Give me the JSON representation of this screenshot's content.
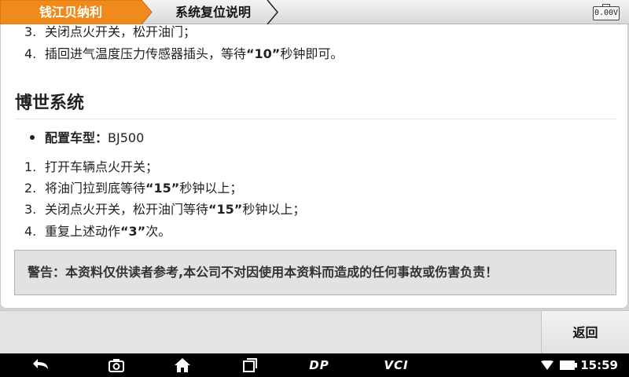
{
  "breadcrumb": {
    "items": [
      {
        "label": "钱江贝纳利",
        "color": "#f08a1c"
      },
      {
        "label": "系统复位说明"
      }
    ]
  },
  "status": {
    "voltage": "0.00V"
  },
  "content": {
    "prev_steps": [
      {
        "num": "3.",
        "pre": "关闭点火开关，松开油门；",
        "bold": "",
        "post": ""
      },
      {
        "num": "4.",
        "pre": "插回进气温度压力传感器插头，等待",
        "bold": "“10”",
        "post": "秒钟即可。"
      }
    ],
    "section_title": "博世系统",
    "config": {
      "label": "配置车型：",
      "value": "BJ500"
    },
    "steps": [
      {
        "num": "1.",
        "pre": "打开车辆点火开关；",
        "bold": "",
        "post": ""
      },
      {
        "num": "2.",
        "pre": "将油门拉到底等待",
        "bold": "“15”",
        "post": "秒钟以上；"
      },
      {
        "num": "3.",
        "pre": "关闭点火开关，松开油门等待",
        "bold": "“15”",
        "post": "秒钟以上；"
      },
      {
        "num": "4.",
        "pre": "重复上述动作",
        "bold": "“3”",
        "post": "次。"
      }
    ],
    "warning": "警告：本资料仅供读者参考,本公司不对因使用本资料而造成的任何事故或伤害负责！"
  },
  "actions": {
    "back_label": "返回"
  },
  "navbar": {
    "icons": [
      "back-icon",
      "camera-icon",
      "home-icon",
      "recent-apps-icon"
    ],
    "dp_label": "DP",
    "vci_label": "VCI",
    "time": "15:59"
  }
}
